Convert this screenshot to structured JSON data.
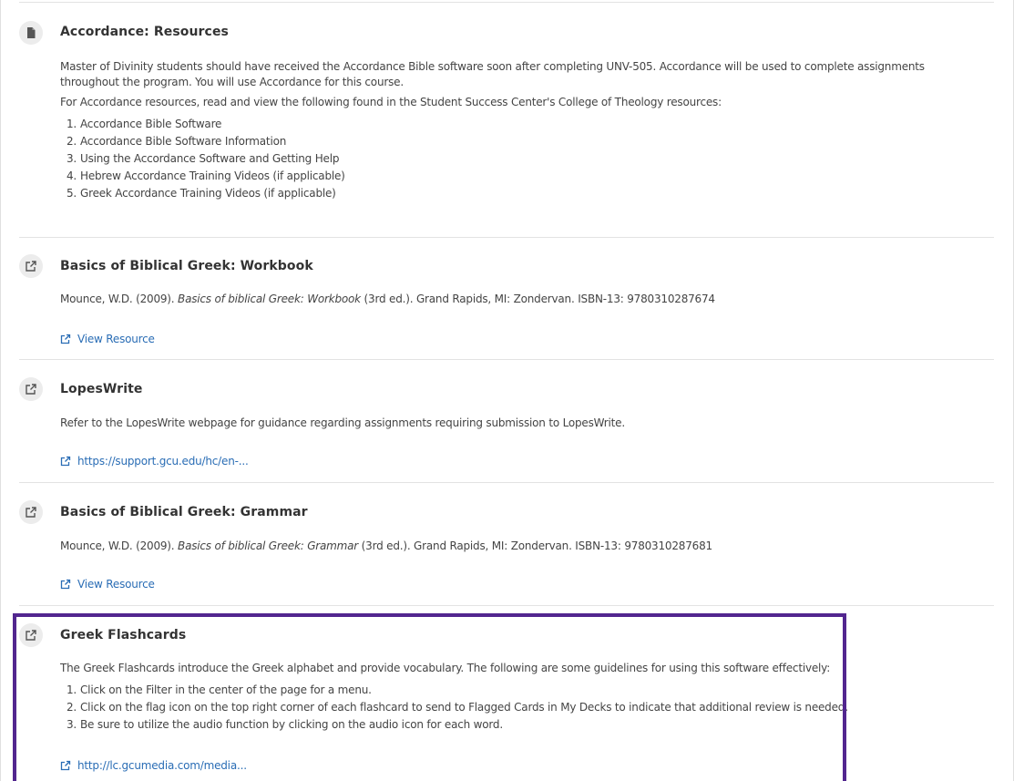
{
  "resources": [
    {
      "title": "Accordance: Resources",
      "icon": "document-icon",
      "paragraphs": [
        "Master of Divinity students should have received the Accordance Bible software soon after completing UNV-505. Accordance will be used to complete assignments throughout the program. You will use Accordance for this course.",
        "For Accordance resources, read and view the following found in the Student Success Center's College of Theology resources:"
      ],
      "list": [
        {
          "num": "1.",
          "text": "Accordance Bible Software"
        },
        {
          "num": "2.",
          "text": "Accordance Bible Software Information"
        },
        {
          "num": "3.",
          "text": "Using the Accordance Software and Getting Help"
        },
        {
          "num": "4.",
          "text": "Hebrew Accordance Training Videos (if applicable)"
        },
        {
          "num": "5.",
          "text": "Greek Accordance Training Videos (if applicable)"
        }
      ]
    },
    {
      "title": "Basics of Biblical Greek: Workbook",
      "icon": "external-link-icon",
      "citation": {
        "pre": "Mounce, W.D. (2009). ",
        "italic": "Basics of biblical Greek: Workbook",
        "post": " (3rd ed.). Grand Rapids, MI: Zondervan. ISBN-13: 9780310287674"
      },
      "link": "View Resource"
    },
    {
      "title": "LopesWrite",
      "icon": "external-link-icon",
      "paragraph": "Refer to the LopesWrite webpage for guidance regarding assignments requiring submission to LopesWrite.",
      "link": "https://support.gcu.edu/hc/en-..."
    },
    {
      "title": "Basics of Biblical Greek: Grammar",
      "icon": "external-link-icon",
      "citation": {
        "pre": "Mounce, W.D. (2009). ",
        "italic": "Basics of biblical Greek: Grammar",
        "post": " (3rd ed.). Grand Rapids, MI: Zondervan. ISBN-13: 9780310287681"
      },
      "link": "View Resource"
    },
    {
      "title": "Greek Flashcards",
      "icon": "external-link-icon",
      "paragraph": "The Greek Flashcards introduce the Greek alphabet and provide vocabulary. The following are some guidelines for using this software effectively:",
      "list": [
        {
          "num": "1.",
          "text": "Click on the Filter in the center of the page for a menu."
        },
        {
          "num": "2.",
          "text": "Click on the flag icon on the top right corner of each flashcard to send to Flagged Cards in My Decks to indicate that additional review is needed."
        },
        {
          "num": "3.",
          "text": "Be sure to utilize the audio function by clicking on the audio icon for each word."
        }
      ],
      "link": "http://lc.gcumedia.com/media..."
    }
  ],
  "colors": {
    "link": "#2a6db5",
    "highlight_border": "#52268f",
    "icon_badge": "#ececec",
    "divider": "#e3e3e3"
  }
}
